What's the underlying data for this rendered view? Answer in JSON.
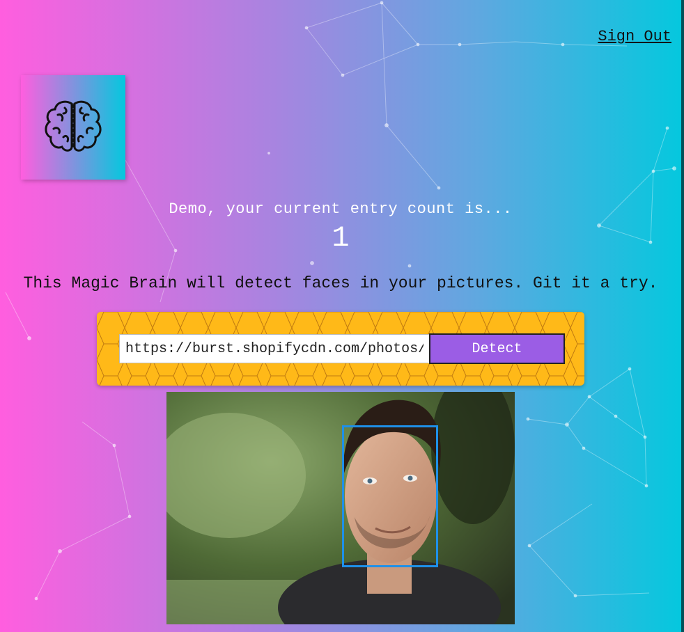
{
  "header": {
    "signout_label": "Sign Out"
  },
  "logo": {
    "icon": "brain-icon"
  },
  "rank": {
    "message": "Demo, your current entry count is...",
    "count": "1"
  },
  "intro": {
    "description": "This Magic Brain will detect faces in your pictures. Git it a try."
  },
  "form": {
    "input_value": "https://burst.shopifycdn.com/photos/",
    "detect_label": "Detect"
  },
  "image": {
    "alt": "man portrait",
    "box_color": "#1e90e8"
  },
  "colors": {
    "gradient_start": "#ff5edf",
    "gradient_end": "#04c8de",
    "panel": "#ffb918",
    "button": "#9b5de5"
  }
}
